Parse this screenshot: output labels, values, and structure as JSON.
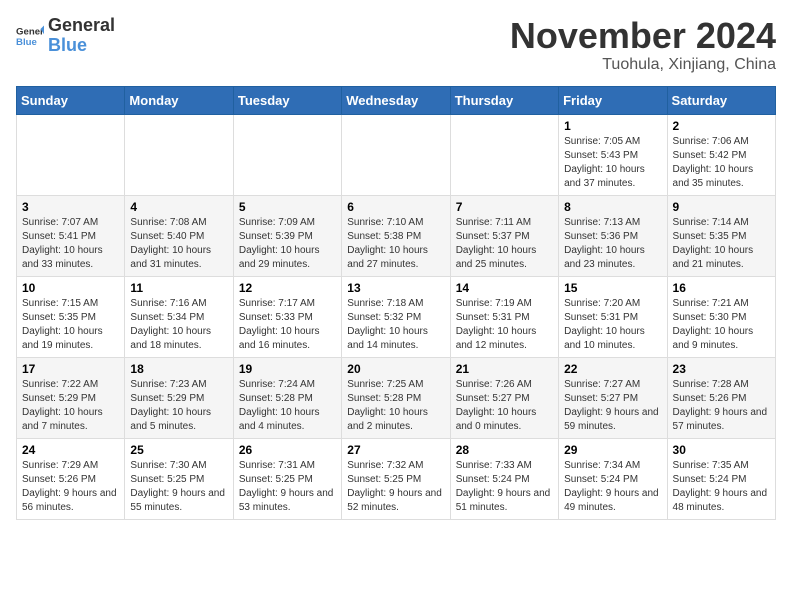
{
  "header": {
    "logo_text_general": "General",
    "logo_text_blue": "Blue",
    "month_title": "November 2024",
    "location": "Tuohula, Xinjiang, China"
  },
  "calendar": {
    "headers": [
      "Sunday",
      "Monday",
      "Tuesday",
      "Wednesday",
      "Thursday",
      "Friday",
      "Saturday"
    ],
    "weeks": [
      [
        {
          "day": "",
          "info": ""
        },
        {
          "day": "",
          "info": ""
        },
        {
          "day": "",
          "info": ""
        },
        {
          "day": "",
          "info": ""
        },
        {
          "day": "",
          "info": ""
        },
        {
          "day": "1",
          "info": "Sunrise: 7:05 AM\nSunset: 5:43 PM\nDaylight: 10 hours and 37 minutes."
        },
        {
          "day": "2",
          "info": "Sunrise: 7:06 AM\nSunset: 5:42 PM\nDaylight: 10 hours and 35 minutes."
        }
      ],
      [
        {
          "day": "3",
          "info": "Sunrise: 7:07 AM\nSunset: 5:41 PM\nDaylight: 10 hours and 33 minutes."
        },
        {
          "day": "4",
          "info": "Sunrise: 7:08 AM\nSunset: 5:40 PM\nDaylight: 10 hours and 31 minutes."
        },
        {
          "day": "5",
          "info": "Sunrise: 7:09 AM\nSunset: 5:39 PM\nDaylight: 10 hours and 29 minutes."
        },
        {
          "day": "6",
          "info": "Sunrise: 7:10 AM\nSunset: 5:38 PM\nDaylight: 10 hours and 27 minutes."
        },
        {
          "day": "7",
          "info": "Sunrise: 7:11 AM\nSunset: 5:37 PM\nDaylight: 10 hours and 25 minutes."
        },
        {
          "day": "8",
          "info": "Sunrise: 7:13 AM\nSunset: 5:36 PM\nDaylight: 10 hours and 23 minutes."
        },
        {
          "day": "9",
          "info": "Sunrise: 7:14 AM\nSunset: 5:35 PM\nDaylight: 10 hours and 21 minutes."
        }
      ],
      [
        {
          "day": "10",
          "info": "Sunrise: 7:15 AM\nSunset: 5:35 PM\nDaylight: 10 hours and 19 minutes."
        },
        {
          "day": "11",
          "info": "Sunrise: 7:16 AM\nSunset: 5:34 PM\nDaylight: 10 hours and 18 minutes."
        },
        {
          "day": "12",
          "info": "Sunrise: 7:17 AM\nSunset: 5:33 PM\nDaylight: 10 hours and 16 minutes."
        },
        {
          "day": "13",
          "info": "Sunrise: 7:18 AM\nSunset: 5:32 PM\nDaylight: 10 hours and 14 minutes."
        },
        {
          "day": "14",
          "info": "Sunrise: 7:19 AM\nSunset: 5:31 PM\nDaylight: 10 hours and 12 minutes."
        },
        {
          "day": "15",
          "info": "Sunrise: 7:20 AM\nSunset: 5:31 PM\nDaylight: 10 hours and 10 minutes."
        },
        {
          "day": "16",
          "info": "Sunrise: 7:21 AM\nSunset: 5:30 PM\nDaylight: 10 hours and 9 minutes."
        }
      ],
      [
        {
          "day": "17",
          "info": "Sunrise: 7:22 AM\nSunset: 5:29 PM\nDaylight: 10 hours and 7 minutes."
        },
        {
          "day": "18",
          "info": "Sunrise: 7:23 AM\nSunset: 5:29 PM\nDaylight: 10 hours and 5 minutes."
        },
        {
          "day": "19",
          "info": "Sunrise: 7:24 AM\nSunset: 5:28 PM\nDaylight: 10 hours and 4 minutes."
        },
        {
          "day": "20",
          "info": "Sunrise: 7:25 AM\nSunset: 5:28 PM\nDaylight: 10 hours and 2 minutes."
        },
        {
          "day": "21",
          "info": "Sunrise: 7:26 AM\nSunset: 5:27 PM\nDaylight: 10 hours and 0 minutes."
        },
        {
          "day": "22",
          "info": "Sunrise: 7:27 AM\nSunset: 5:27 PM\nDaylight: 9 hours and 59 minutes."
        },
        {
          "day": "23",
          "info": "Sunrise: 7:28 AM\nSunset: 5:26 PM\nDaylight: 9 hours and 57 minutes."
        }
      ],
      [
        {
          "day": "24",
          "info": "Sunrise: 7:29 AM\nSunset: 5:26 PM\nDaylight: 9 hours and 56 minutes."
        },
        {
          "day": "25",
          "info": "Sunrise: 7:30 AM\nSunset: 5:25 PM\nDaylight: 9 hours and 55 minutes."
        },
        {
          "day": "26",
          "info": "Sunrise: 7:31 AM\nSunset: 5:25 PM\nDaylight: 9 hours and 53 minutes."
        },
        {
          "day": "27",
          "info": "Sunrise: 7:32 AM\nSunset: 5:25 PM\nDaylight: 9 hours and 52 minutes."
        },
        {
          "day": "28",
          "info": "Sunrise: 7:33 AM\nSunset: 5:24 PM\nDaylight: 9 hours and 51 minutes."
        },
        {
          "day": "29",
          "info": "Sunrise: 7:34 AM\nSunset: 5:24 PM\nDaylight: 9 hours and 49 minutes."
        },
        {
          "day": "30",
          "info": "Sunrise: 7:35 AM\nSunset: 5:24 PM\nDaylight: 9 hours and 48 minutes."
        }
      ]
    ]
  }
}
